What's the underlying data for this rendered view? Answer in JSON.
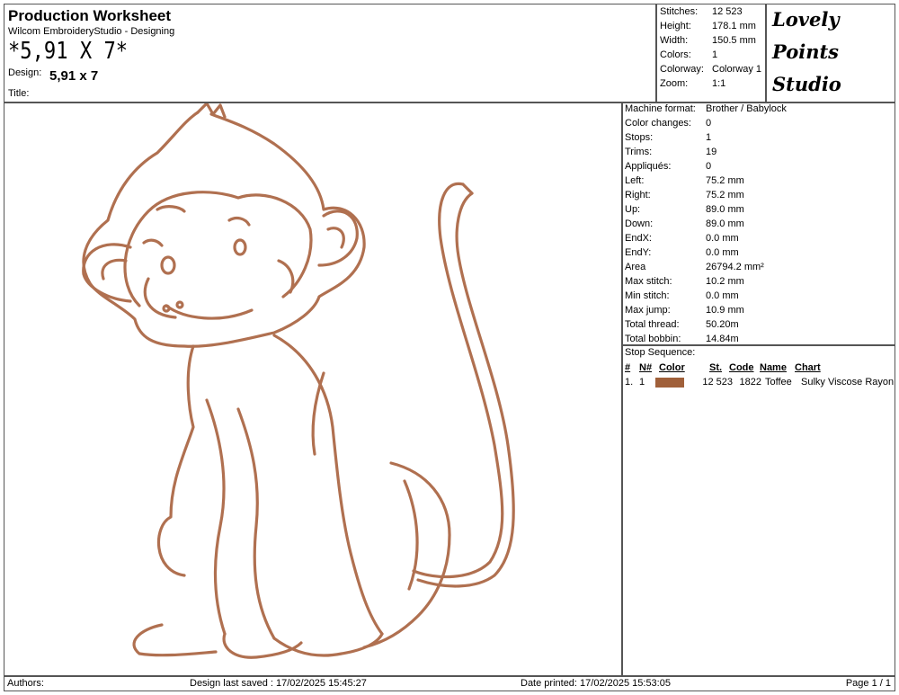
{
  "header": {
    "title": "Production Worksheet",
    "subtitle": "Wilcom EmbroideryStudio - Designing",
    "barcode_text": "*5,91 X 7*",
    "design_label": "Design:",
    "design_value": "5,91 x 7",
    "title_label": "Title:"
  },
  "stats": [
    {
      "label": "Stitches:",
      "value": "12 523"
    },
    {
      "label": "Height:",
      "value": "178.1 mm"
    },
    {
      "label": "Width:",
      "value": "150.5 mm"
    },
    {
      "label": "Colors:",
      "value": "1"
    },
    {
      "label": "Colorway:",
      "value": "Colorway 1"
    },
    {
      "label": "Zoom:",
      "value": "1:1"
    }
  ],
  "logo": {
    "line1": "Lovely",
    "line2": "Points",
    "line3": "Studio"
  },
  "specs": [
    {
      "label": "Machine format:",
      "value": "Brother / Babylock"
    },
    {
      "label": "Color changes:",
      "value": "0"
    },
    {
      "label": "Stops:",
      "value": "1"
    },
    {
      "label": "Trims:",
      "value": "19"
    },
    {
      "label": "Appliqués:",
      "value": "0"
    },
    {
      "label": "Left:",
      "value": "75.2 mm"
    },
    {
      "label": "Right:",
      "value": "75.2 mm"
    },
    {
      "label": "Up:",
      "value": "89.0 mm"
    },
    {
      "label": "Down:",
      "value": "89.0 mm"
    },
    {
      "label": "EndX:",
      "value": "0.0 mm"
    },
    {
      "label": "EndY:",
      "value": "0.0 mm"
    },
    {
      "label": "Area",
      "value": "26794.2 mm²"
    },
    {
      "label": "Max stitch:",
      "value": "10.2 mm"
    },
    {
      "label": "Min stitch:",
      "value": "0.0 mm"
    },
    {
      "label": "Max jump:",
      "value": "10.9 mm"
    },
    {
      "label": "Total thread:",
      "value": "50.20m"
    },
    {
      "label": "Total bobbin:",
      "value": "14.84m"
    }
  ],
  "stop_sequence": {
    "title": "Stop Sequence:",
    "headers": {
      "num": "#",
      "needle": "N#",
      "color": "Color",
      "st": "St.",
      "code": "Code",
      "name": "Name",
      "chart": "Chart"
    },
    "rows": [
      {
        "num": "1.",
        "needle": "1",
        "color": "#a0603a",
        "st": "12 523",
        "code": "1822",
        "name": "Toffee",
        "chart": "Sulky Viscose Rayon"
      }
    ]
  },
  "design_colors": {
    "thread": "#b07050",
    "thread_dark": "#8a4f30"
  },
  "footer": {
    "authors": "Authors:",
    "saved": "Design last saved : 17/02/2025 15:45:27",
    "printed": "Date printed: 17/02/2025 15:53:05",
    "page": "Page 1 / 1"
  }
}
